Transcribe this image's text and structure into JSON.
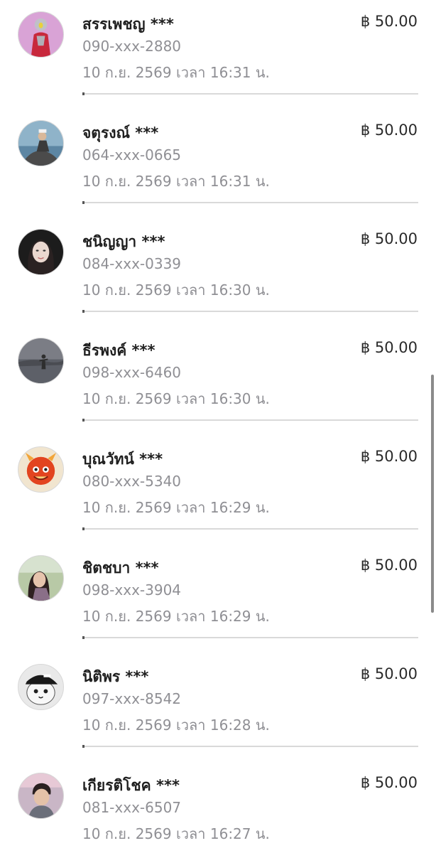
{
  "currency_symbol": "฿",
  "transactions": [
    {
      "name": "สรรเพชญ ***",
      "phone": "090-xxx-2880",
      "time": "10 ก.ย. 2569 เวลา 16:31 น.",
      "amount": "฿ 50.00"
    },
    {
      "name": "จตุรงณ์ ***",
      "phone": "064-xxx-0665",
      "time": "10 ก.ย. 2569 เวลา 16:31 น.",
      "amount": "฿ 50.00"
    },
    {
      "name": "ชนิญญา ***",
      "phone": "084-xxx-0339",
      "time": "10 ก.ย. 2569 เวลา 16:30 น.",
      "amount": "฿ 50.00"
    },
    {
      "name": "ธีรพงค์ ***",
      "phone": "098-xxx-6460",
      "time": "10 ก.ย. 2569 เวลา 16:30 น.",
      "amount": "฿ 50.00"
    },
    {
      "name": "บุณวัทน์ ***",
      "phone": "080-xxx-5340",
      "time": "10 ก.ย. 2569 เวลา 16:29 น.",
      "amount": "฿ 50.00"
    },
    {
      "name": "ชิตชบา ***",
      "phone": "098-xxx-3904",
      "time": "10 ก.ย. 2569 เวลา 16:29 น.",
      "amount": "฿ 50.00"
    },
    {
      "name": "นิติพร ***",
      "phone": "097-xxx-8542",
      "time": "10 ก.ย. 2569 เวลา 16:28 น.",
      "amount": "฿ 50.00"
    },
    {
      "name": "เกียรติโชค ***",
      "phone": "081-xxx-6507",
      "time": "10 ก.ย. 2569 เวลา 16:27 น.",
      "amount": "฿ 50.00"
    }
  ],
  "avatars": [
    {
      "icon": "superhero-avatar-icon",
      "bg": "#d9a3d6",
      "fg": "#c8283c"
    },
    {
      "icon": "person-on-rocks-avatar-icon",
      "bg": "#8fb3c9",
      "fg": "#3b3b3b"
    },
    {
      "icon": "woman-portrait-avatar-icon",
      "bg": "#1c1c1c",
      "fg": "#e8d3c8"
    },
    {
      "icon": "person-at-beach-avatar-icon",
      "bg": "#7b7d85",
      "fg": "#2e2e2e"
    },
    {
      "icon": "red-dragon-avatar-icon",
      "bg": "#f1e5cf",
      "fg": "#e2441f"
    },
    {
      "icon": "woman-outdoor-avatar-icon",
      "bg": "#b8c9a6",
      "fg": "#4a3a3a"
    },
    {
      "icon": "cat-with-cap-avatar-icon",
      "bg": "#e9e9e9",
      "fg": "#1a1a1a"
    },
    {
      "icon": "boy-portrait-avatar-icon",
      "bg": "#c9b6c6",
      "fg": "#3b2f2f"
    }
  ]
}
